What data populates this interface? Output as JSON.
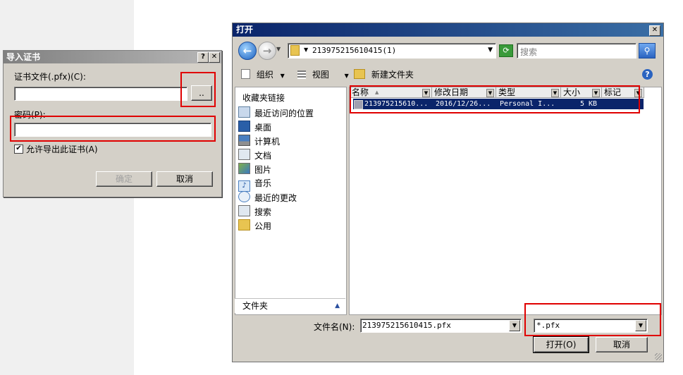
{
  "import_dialog": {
    "title": "导入证书",
    "help_btn": "?",
    "close_btn": "✕",
    "cert_file_label": "证书文件(.pfx)(C):",
    "cert_file_value": "",
    "browse_label": "..",
    "password_label": "密码(P):",
    "password_value": "",
    "allow_export_label": "允许导出此证书(A)",
    "allow_export_checked": true,
    "ok_label": "确定",
    "cancel_label": "取消"
  },
  "open_dialog": {
    "title": "打开",
    "close_btn": "✕",
    "address": "213975215610415(1)",
    "search_placeholder": "搜索",
    "toolbar": {
      "organize": "组织",
      "views": "视图",
      "new_folder": "新建文件夹"
    },
    "nav": {
      "favorites_header": "收藏夹链接",
      "items": [
        {
          "label": "最近访问的位置",
          "icon": "recent-places-icon"
        },
        {
          "label": "桌面",
          "icon": "desktop-icon"
        },
        {
          "label": "计算机",
          "icon": "computer-icon"
        },
        {
          "label": "文档",
          "icon": "documents-icon"
        },
        {
          "label": "图片",
          "icon": "pictures-icon"
        },
        {
          "label": "音乐",
          "icon": "music-icon"
        },
        {
          "label": "最近的更改",
          "icon": "recent-changes-icon"
        },
        {
          "label": "搜索",
          "icon": "search-icon"
        },
        {
          "label": "公用",
          "icon": "public-folder-icon"
        }
      ],
      "folders_label": "文件夹"
    },
    "columns": [
      "名称",
      "修改日期",
      "类型",
      "大小",
      "标记"
    ],
    "files": [
      {
        "name": "213975215610...",
        "date": "2016/12/26...",
        "type": "Personal I...",
        "size": "5 KB",
        "tag": ""
      }
    ],
    "filename_label": "文件名(N):",
    "filename_value": "213975215610415.pfx",
    "filetype_value": "*.pfx",
    "open_label": "打开(O)",
    "cancel_label": "取消"
  }
}
